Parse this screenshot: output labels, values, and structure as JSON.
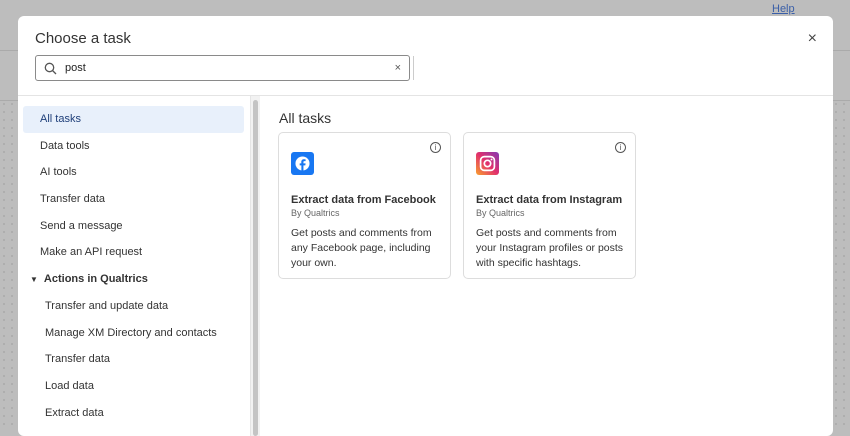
{
  "background": {
    "link_text": "Help"
  },
  "modal": {
    "title": "Choose a task",
    "close_label": "×"
  },
  "search": {
    "value": "post",
    "clear_label": "×"
  },
  "sidebar": {
    "items": [
      {
        "label": "All tasks",
        "type": "item",
        "active": true
      },
      {
        "label": "Data tools",
        "type": "item"
      },
      {
        "label": "AI tools",
        "type": "item"
      },
      {
        "label": "Transfer data",
        "type": "item"
      },
      {
        "label": "Send a message",
        "type": "item"
      },
      {
        "label": "Make an API request",
        "type": "item"
      },
      {
        "label": "Actions in Qualtrics",
        "type": "head"
      },
      {
        "label": "Transfer and update data",
        "type": "sub"
      },
      {
        "label": "Manage XM Directory and contacts",
        "type": "sub"
      },
      {
        "label": "Transfer data",
        "type": "sub"
      },
      {
        "label": "Load data",
        "type": "sub"
      },
      {
        "label": "Extract data",
        "type": "sub"
      }
    ]
  },
  "main": {
    "title": "All tasks",
    "cards": [
      {
        "title": "Extract data from Facebook",
        "by": "By Qualtrics",
        "description": "Get posts and comments from any Facebook page, including your own.",
        "icon": "facebook-icon",
        "color": "#1877f2"
      },
      {
        "title": "Extract data from Instagram",
        "by": "By Qualtrics",
        "description": "Get posts and comments from your Instagram profiles or posts with specific hashtags.",
        "icon": "instagram-icon"
      }
    ]
  }
}
